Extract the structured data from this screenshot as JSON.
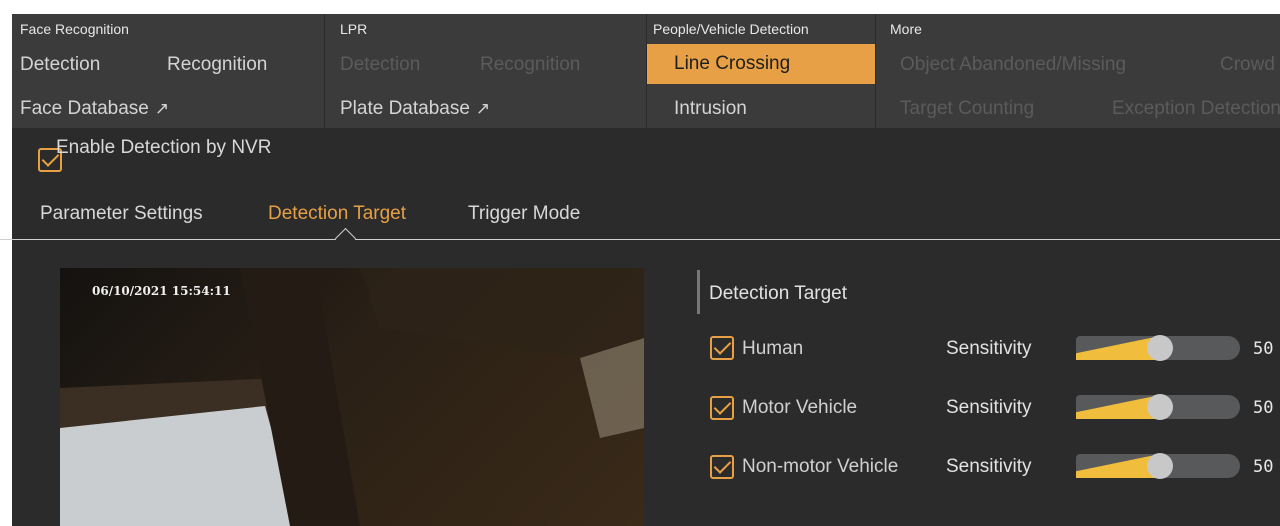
{
  "menu": {
    "face_recognition": {
      "title": "Face Recognition",
      "detection": "Detection",
      "recognition": "Recognition",
      "face_database": "Face Database"
    },
    "lpr": {
      "title": "LPR",
      "detection": "Detection",
      "recognition": "Recognition",
      "plate_database": "Plate Database"
    },
    "people_vehicle": {
      "title": "People/Vehicle Detection",
      "line_crossing": "Line Crossing",
      "intrusion": "Intrusion"
    },
    "more": {
      "title": "More",
      "object_abandoned": "Object Abandoned/Missing",
      "crowd": "Crowd",
      "target_counting": "Target Counting",
      "exception_detection": "Exception Detection"
    }
  },
  "enable": {
    "label": "Enable Detection by NVR",
    "checked": true
  },
  "tabs": [
    "Parameter Settings",
    "Detection Target",
    "Trigger Mode"
  ],
  "active_tab": "Detection Target",
  "video": {
    "timestamp": "06/10/2021 15:54:11"
  },
  "panel": {
    "title": "Detection Target",
    "sensitivity_label": "Sensitivity",
    "targets": [
      {
        "label": "Human",
        "checked": true,
        "sensitivity": "50"
      },
      {
        "label": "Motor Vehicle",
        "checked": true,
        "sensitivity": "50"
      },
      {
        "label": "Non-motor Vehicle",
        "checked": true,
        "sensitivity": "50"
      }
    ]
  },
  "colors": {
    "accent": "#e7a045",
    "slider_fill": "#f0be3c",
    "background": "#2b2b2b",
    "menu_bg": "#3b3b3b"
  }
}
